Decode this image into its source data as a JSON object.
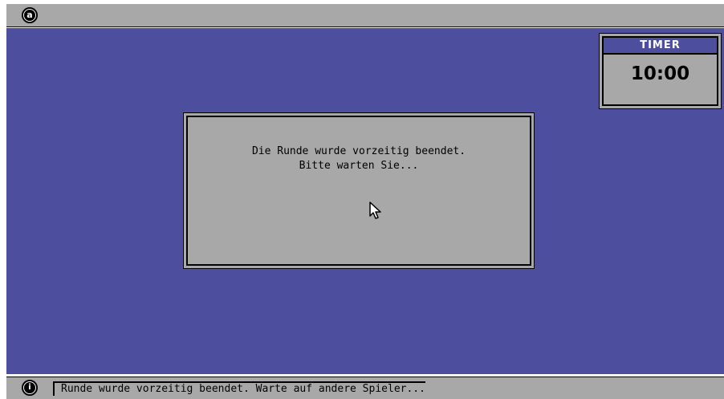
{
  "menubar": {
    "app_icon": "a"
  },
  "timer": {
    "title": "TIMER",
    "value": "10:00"
  },
  "dialog": {
    "line1": "Die Runde wurde vorzeitig beendet.",
    "line2": "Bitte warten Sie..."
  },
  "statusbar": {
    "info_icon": "i",
    "message": "Runde wurde vorzeitig beendet. Warte auf andere Spieler..."
  },
  "colors": {
    "desktop": "#4d4e9e",
    "panel": "#a8a8a8"
  }
}
